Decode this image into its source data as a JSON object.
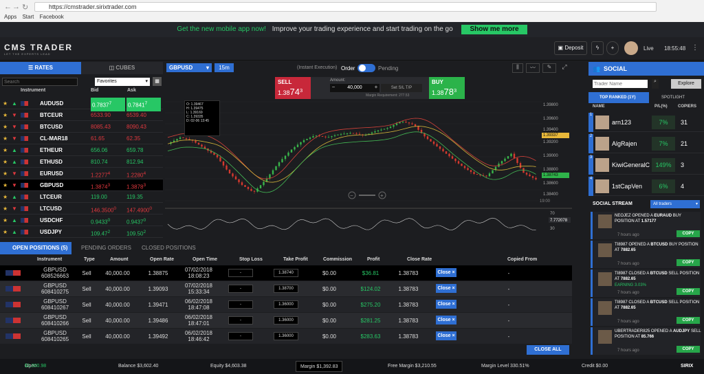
{
  "browser": {
    "url": "https://cmstrader.sirixtrader.com",
    "bookmarks": [
      "Apps",
      "Start",
      "Facebook"
    ]
  },
  "promo": {
    "title": "Get the new mobile app now!",
    "text": "Improve your trading experience and start trading on the go",
    "button": "Show me more"
  },
  "header": {
    "logo": "CMS TRADER",
    "tagline": "LET THE EXPERTS LEAD",
    "deposit": "Deposit",
    "mode": "Live",
    "time": "18:55:48"
  },
  "rates": {
    "tabs": [
      "RATES",
      "CUBES"
    ],
    "search_placeholder": "Search",
    "list": "Favorites",
    "columns": [
      "Instrument",
      "Bid",
      "Ask"
    ],
    "rows": [
      {
        "name": "AUDUSD",
        "bid": "0.7837",
        "bid_sup": "7",
        "ask": "0.7841",
        "ask_sup": "7",
        "dir": "up"
      },
      {
        "name": "BTCEUR",
        "bid": "6533.90",
        "ask": "6539.40",
        "dir": "dn"
      },
      {
        "name": "BTCUSD",
        "bid": "8085.43",
        "ask": "8090.43",
        "dir": "dn"
      },
      {
        "name": "CL-MAR18",
        "bid": "61.65",
        "ask": "62.35",
        "dir": "dn"
      },
      {
        "name": "ETHEUR",
        "bid": "656.06",
        "ask": "659.78",
        "dir": "up"
      },
      {
        "name": "ETHUSD",
        "bid": "810.74",
        "ask": "812.94",
        "dir": "up"
      },
      {
        "name": "EURUSD",
        "bid": "1.2277",
        "bid_sup": "4",
        "ask": "1.2280",
        "ask_sup": "4",
        "dir": "dn"
      },
      {
        "name": "GBPUSD",
        "bid": "1.3874",
        "bid_sup": "3",
        "ask": "1.3878",
        "ask_sup": "3",
        "dir": "dn"
      },
      {
        "name": "LTCEUR",
        "bid": "119.00",
        "ask": "119.35",
        "dir": "up"
      },
      {
        "name": "LTCUSD",
        "bid": "146.3500",
        "bid_sup": "0",
        "ask": "147.4900",
        "ask_sup": "0",
        "dir": "dn"
      },
      {
        "name": "USDCHF",
        "bid": "0.9433",
        "bid_sup": "0",
        "ask": "0.9437",
        "ask_sup": "0",
        "dir": "up"
      },
      {
        "name": "USDJPY",
        "bid": "109.47",
        "bid_sup": "2",
        "ask": "109.50",
        "ask_sup": "2",
        "dir": "up"
      }
    ]
  },
  "chart": {
    "symbol": "GBPUSD",
    "timeframe": "15m",
    "exec": "(Instant Execution)",
    "order": "Order",
    "pending": "Pending",
    "sell_label": "SELL",
    "sell_price": "1.38",
    "sell_big": "74",
    "sell_sup": "3",
    "buy_label": "BUY",
    "buy_price": "1.38",
    "buy_big": "78",
    "buy_sup": "3",
    "amount_label": "Amount:",
    "amount": "40,000",
    "sltp": "Set S/L T/P",
    "margin_req": "Margin Requirement: 277.53",
    "ohlc": [
      {
        "k": "O:",
        "v": "1.39467"
      },
      {
        "k": "H:",
        "v": "1.39475"
      },
      {
        "k": "L:",
        "v": "1.39169"
      },
      {
        "k": "C:",
        "v": "1.39335"
      },
      {
        "k": "D:",
        "v": "02-06 13:45"
      }
    ],
    "yticks": [
      "1.39800",
      "1.39600",
      "1.39400",
      "1.39337",
      "1.39200",
      "1.39000",
      "1.38800",
      "1.38743",
      "1.38600",
      "1.38400"
    ],
    "xtick": "19:00",
    "rsi_top": "70",
    "rsi_val": "7.772078",
    "rsi_bot": "30"
  },
  "positions": {
    "tabs": [
      "OPEN POSITIONS (5)",
      "PENDING ORDERS",
      "CLOSED POSITIONS"
    ],
    "columns": [
      "Instrument",
      "Type",
      "Amount",
      "Open Rate",
      "Open Time",
      "Stop Loss",
      "Take Profit",
      "Commission",
      "Profit",
      "Close Rate",
      "Copied From"
    ],
    "rows": [
      {
        "inst": "GBPUSD",
        "id": "608526663",
        "type": "Sell",
        "amount": "40,000.00",
        "rate": "1.38875",
        "date": "07/02/2018",
        "time": "18:08:23",
        "sl": "-",
        "tp": "1.38740",
        "comm": "$0.00",
        "profit": "$36.81",
        "close": "1.38783",
        "btn": "Close ×",
        "copied": "-"
      },
      {
        "inst": "GBPUSD",
        "id": "608410275",
        "type": "Sell",
        "amount": "40,000.00",
        "rate": "1.39093",
        "date": "07/02/2018",
        "time": "15:33:34",
        "sl": "-",
        "tp": "1.38700",
        "comm": "$0.00",
        "profit": "$124.02",
        "close": "1.38783",
        "btn": "Close ×",
        "copied": "-"
      },
      {
        "inst": "GBPUSD",
        "id": "608410267",
        "type": "Sell",
        "amount": "40,000.00",
        "rate": "1.39471",
        "date": "06/02/2018",
        "time": "18:47:08",
        "sl": "-",
        "tp": "1.36000",
        "comm": "$0.00",
        "profit": "$275.20",
        "close": "1.38783",
        "btn": "Close ×",
        "copied": "-"
      },
      {
        "inst": "GBPUSD",
        "id": "608410266",
        "type": "Sell",
        "amount": "40,000.00",
        "rate": "1.39486",
        "date": "06/02/2018",
        "time": "18:47:01",
        "sl": "-",
        "tp": "1.36000",
        "comm": "$0.00",
        "profit": "$281.25",
        "close": "1.38783",
        "btn": "Close ×",
        "copied": "-"
      },
      {
        "inst": "GBPUSD",
        "id": "608410265",
        "type": "Sell",
        "amount": "40,000.00",
        "rate": "1.39492",
        "date": "06/02/2018",
        "time": "18:46:42",
        "sl": "-",
        "tp": "1.36000",
        "comm": "$0.00",
        "profit": "$283.63",
        "close": "1.38783",
        "btn": "Close ×",
        "copied": "-"
      }
    ],
    "close_all": "CLOSE ALL"
  },
  "social": {
    "title": "SOCIAL",
    "search_placeholder": "Trader Name",
    "explore": "Explore",
    "tabs": [
      "TOP RANKED (1Y)",
      "SPOTLIGHT"
    ],
    "columns": [
      "NAME",
      "P/L(%)",
      "COPIERS"
    ],
    "traders": [
      {
        "rank": "1",
        "name": "arn123",
        "pl": "7%",
        "copiers": "31"
      },
      {
        "rank": "2",
        "name": "AlgRajen",
        "pl": "7%",
        "copiers": "21"
      },
      {
        "rank": "3",
        "name": "KiwiGeneralC",
        "pl": "149%",
        "copiers": "3"
      },
      {
        "rank": "4",
        "name": "1stCapVen",
        "pl": "6%",
        "copiers": "4"
      }
    ],
    "stream_title": "SOCIAL STREAM",
    "stream_filter": "All traders",
    "feed": [
      {
        "who": "NEOJEZ",
        "action": "OPENED A",
        "sym": "EURAUD",
        "side": "BUY",
        "text": "POSITION AT",
        "price": "1.57177",
        "ago": "7 hours ago",
        "extra": ""
      },
      {
        "who": "TI8987",
        "action": "OPENED A",
        "sym": "BTCUSD",
        "side": "BUY",
        "text": "POSITION AT",
        "price": "7882.65",
        "ago": "7 hours ago",
        "extra": ""
      },
      {
        "who": "TI8987",
        "action": "CLOSED A",
        "sym": "BTCUSD",
        "side": "SELL",
        "text": "POSITION AT",
        "price": "7882.65",
        "ago": "7 hours ago",
        "extra": "EARNING 3.03%"
      },
      {
        "who": "TI8987",
        "action": "CLOSED A",
        "sym": "BTCUSD",
        "side": "SELL",
        "text": "POSITION AT",
        "price": "7882.65",
        "ago": "7 hours ago",
        "extra": ""
      },
      {
        "who": "UBERTRADER825",
        "action": "OPENED A",
        "sym": "AUDJPY",
        "side": "SELL",
        "text": "POSITION AT",
        "price": "85.766",
        "ago": "7 hours ago",
        "extra": ""
      }
    ],
    "copy": "COPY"
  },
  "footer": {
    "open_pl_label": "Open P/L",
    "open_pl": "$1,000.98",
    "balance": "Balance $3,602.40",
    "equity": "Equity $4,603.38",
    "margin": "Margin $1,392.83",
    "free_margin": "Free Margin $3,210.55",
    "margin_level": "Margin Level 330.51%",
    "credit": "Credit $0.00",
    "brand": "SIRIX"
  },
  "colors": {
    "green": "#27c765",
    "red": "#e0383e",
    "blue": "#2f6fd3"
  }
}
